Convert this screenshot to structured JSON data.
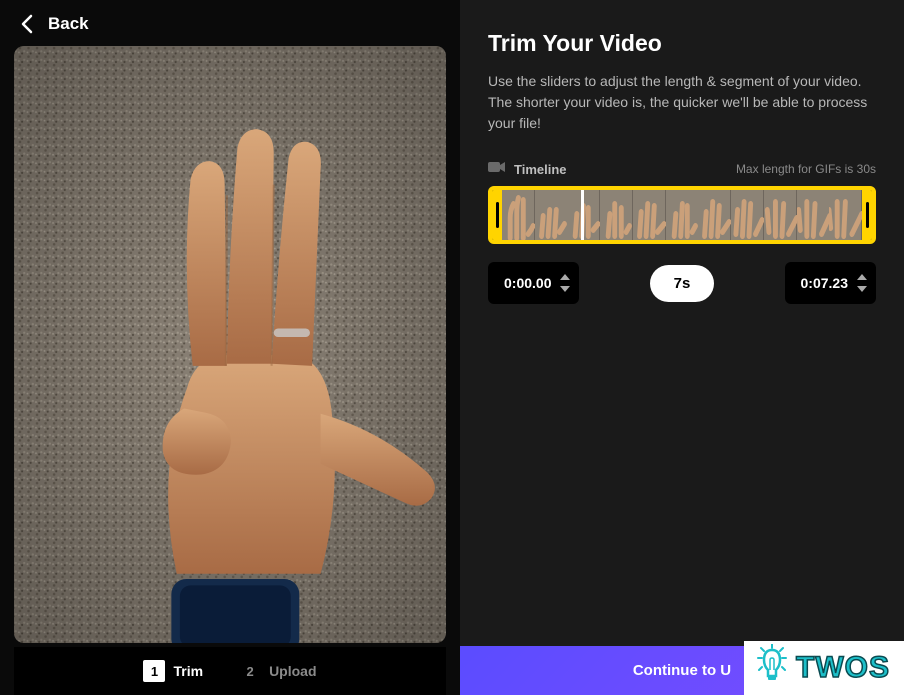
{
  "back_label": "Back",
  "steps": [
    {
      "num": "1",
      "label": "Trim"
    },
    {
      "num": "2",
      "label": "Upload"
    }
  ],
  "title": "Trim Your Video",
  "description": "Use the sliders to adjust the length & segment of your video. The shorter your video is, the quicker we'll be able to process your file!",
  "timeline_label": "Timeline",
  "max_length_text": "Max length for GIFs is 30s",
  "start_time": "0:00.00",
  "end_time": "0:07.23",
  "duration": "7s",
  "continue_label": "Continue to U",
  "watermark": "TWOS",
  "colors": {
    "selection": "#ffd400",
    "continue_gradient_start": "#5b4cff",
    "continue_gradient_end": "#7a4dff",
    "watermark": "#1dbfc9"
  }
}
